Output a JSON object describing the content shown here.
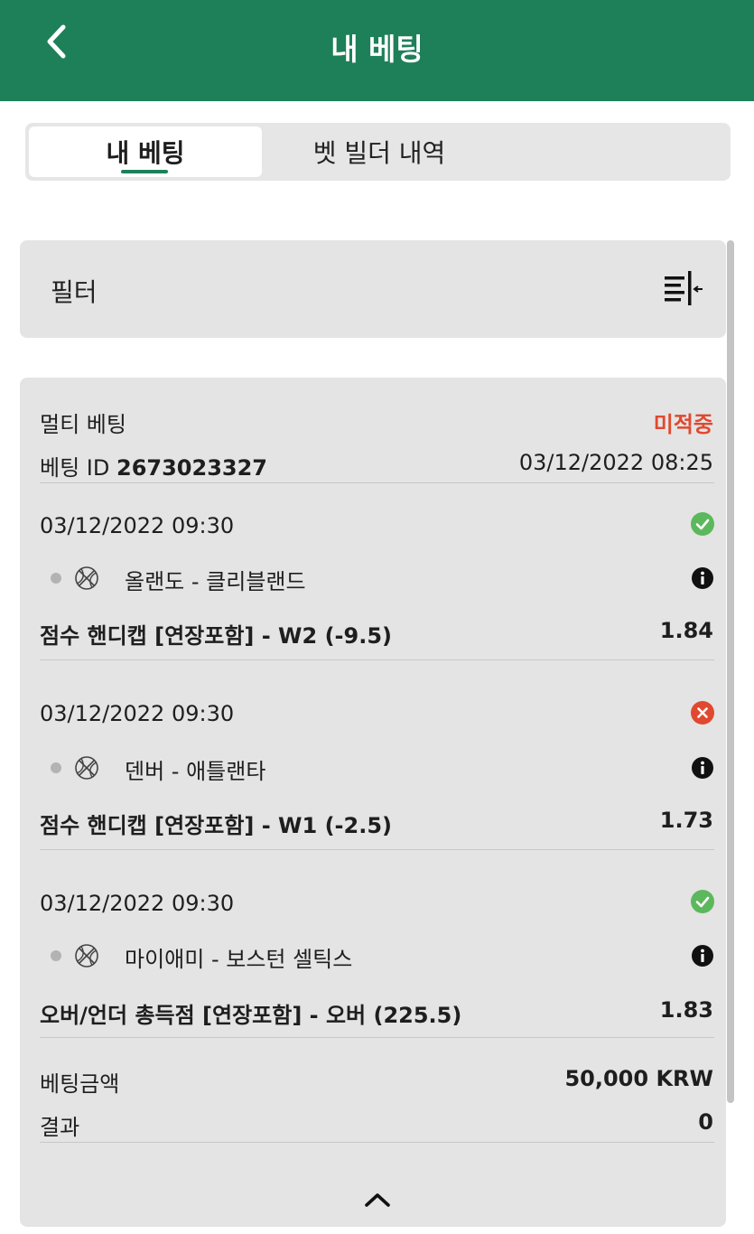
{
  "header": {
    "title": "내 베팅",
    "back_icon": "chevron-left-icon"
  },
  "tabs": [
    {
      "label": "내 베팅",
      "active": true
    },
    {
      "label": "벳 빌더 내역",
      "active": false
    }
  ],
  "filter": {
    "label": "필터",
    "icon": "filter-collapse-icon"
  },
  "bet": {
    "type": "멀티 베팅",
    "status": "미적중",
    "status_color": "#e0492f",
    "id_label": "베팅 ID",
    "id_value": "2673023327",
    "placed_at": "03/12/2022 08:25",
    "selections": [
      {
        "datetime": "03/12/2022 09:30",
        "result": "won",
        "result_icon": "check-circle-icon",
        "sport_icon": "basketball-icon",
        "teams": "올랜도 - 클리블랜드",
        "market": "점수 핸디캡 [연장포함] - W2 (-9.5)",
        "odds": "1.84"
      },
      {
        "datetime": "03/12/2022 09:30",
        "result": "lost",
        "result_icon": "x-circle-icon",
        "sport_icon": "basketball-icon",
        "teams": "덴버 - 애틀랜타",
        "market": "점수 핸디캡 [연장포함] - W1 (-2.5)",
        "odds": "1.73"
      },
      {
        "datetime": "03/12/2022 09:30",
        "result": "won",
        "result_icon": "check-circle-icon",
        "sport_icon": "basketball-icon",
        "teams": "마이애미 - 보스턴 셀틱스",
        "market": "오버/언더 총득점 [연장포함] - 오버 (225.5)",
        "odds": "1.83"
      }
    ],
    "stake_label": "베팅금액",
    "stake_value": "50,000 KRW",
    "result_label": "결과",
    "result_value": "0"
  },
  "colors": {
    "brand": "#1d8059",
    "won": "#5cb85c",
    "lost": "#e0492f"
  }
}
